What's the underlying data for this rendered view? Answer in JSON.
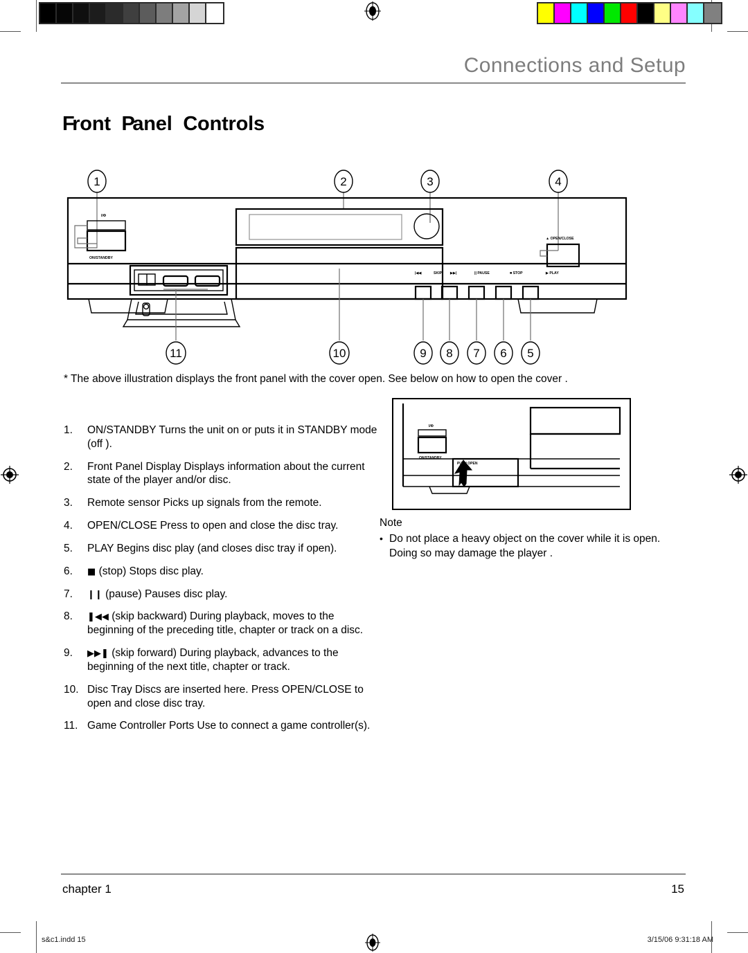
{
  "header": {
    "chapter_heading": "Connections and Setup",
    "section_title_parts": [
      "F",
      "ront",
      "P",
      "anel",
      "Controls"
    ],
    "section_title": "Front Panel Controls"
  },
  "figure": {
    "caption": "* The above illustration displays the front panel with the cover open. See below on how to open the cover .",
    "callouts_top": [
      "1",
      "2",
      "3",
      "4"
    ],
    "callouts_bottom": [
      "11",
      "10",
      "9",
      "8",
      "7",
      "6",
      "5"
    ],
    "labels": {
      "power_symbol": "I/Φ",
      "power_button": "ON/STANDBY",
      "open_close": "▲ OPEN/CLOSE",
      "skip_back": "|◀◀",
      "skip_label": "SKIP",
      "skip_fwd": "▶▶|",
      "pause": "|| PAUSE",
      "stop": "■ STOP",
      "play": "▶ PLAY"
    }
  },
  "controls_list": [
    {
      "num": "1.",
      "text": "ON/STANDBY  Turns the unit on or puts it in STANDBY mode (off )."
    },
    {
      "num": "2.",
      "text": "Front Panel Display  Displays information about the current state of the player and/or disc."
    },
    {
      "num": "3.",
      "text": "Remote sensor  Picks up signals from the remote."
    },
    {
      "num": "4.",
      "text": "OPEN/CLOSE  Press to open and close the disc tray."
    },
    {
      "num": "5.",
      "text": "PLAY  Begins disc play (and closes disc tray if open)."
    },
    {
      "num": "6.",
      "glyph": "■",
      "text": "(stop)  Stops disc play."
    },
    {
      "num": "7.",
      "glyph": "❙❙",
      "text": "(pause)  Pauses disc play."
    },
    {
      "num": "8.",
      "glyph": "❚◀◀",
      "text": "(skip backward)  During playback, moves to the beginning of the preceding title, chapter or track on a disc."
    },
    {
      "num": "9.",
      "glyph": "▶▶❚",
      "text": "(skip forward)  During playback, advances to the beginning of  the next title, chapter or track."
    },
    {
      "num": "10.",
      "text": "Disc Tray  Discs are inserted here. Press OPEN/CLOSE to open and close disc tray."
    },
    {
      "num": "11.",
      "text": "Game Controller Ports  Use to connect a game controller(s)."
    }
  ],
  "note": {
    "heading": "Note",
    "bullet": "•",
    "text": "Do not place a heavy object on the cover while it is open. Doing so may damage the player .",
    "figure_labels": {
      "power_symbol": "I/Φ",
      "power_button": "ON/STANDBY",
      "push_open": "PUSH OPEN"
    }
  },
  "footer": {
    "left": "chapter  1",
    "page_number": "15"
  },
  "slug": {
    "file": "s&c1.indd  15",
    "timestamp": "3/15/06  9:31:18 AM"
  },
  "calibration": {
    "grayscale": [
      "#000000",
      "#060606",
      "#0f0f0f",
      "#1c1c1c",
      "#2b2b2b",
      "#3f3f3f",
      "#5c5c5c",
      "#7d7d7d",
      "#a3a3a3",
      "#d5d5d5",
      "#ffffff"
    ],
    "colors": [
      "#ffff00",
      "#ff00ff",
      "#00ffff",
      "#0000ff",
      "#00e800",
      "#ff0000",
      "#000000",
      "#ffff85",
      "#ff85ff",
      "#85ffff",
      "#808080"
    ]
  }
}
